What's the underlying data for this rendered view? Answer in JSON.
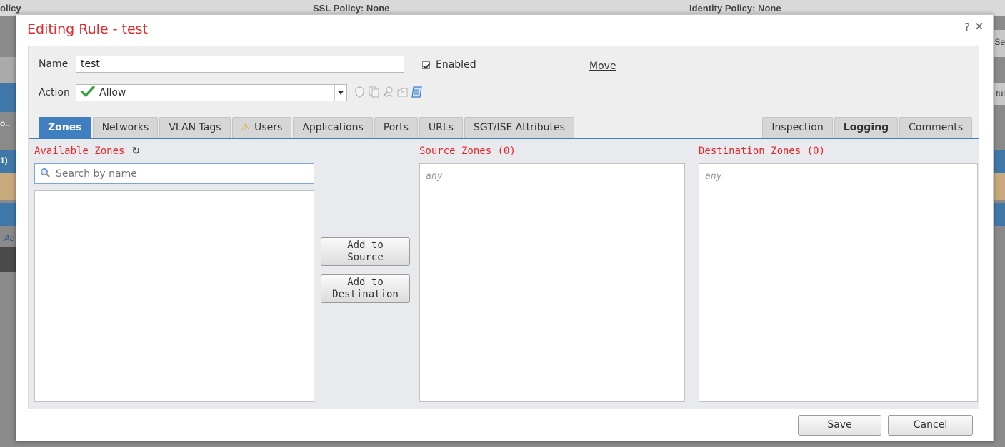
{
  "background": {
    "left_text": "olicy",
    "ssl_policy": "SSL Policy: None",
    "identity_policy": "Identity Policy: None",
    "right_text_1": "Se",
    "right_text_2": "tul",
    "left_text_2": "o..",
    "left_text_3": "1)",
    "left_text_4": "Ac"
  },
  "dialog": {
    "title": "Editing Rule - test",
    "help_label": "?",
    "close_label": "×"
  },
  "form": {
    "name_label": "Name",
    "name_value": "test",
    "enabled_label": "Enabled",
    "enabled_checked": true,
    "move_label": "Move",
    "action_label": "Action",
    "action_value": "Allow",
    "action_icons": [
      "shield-icon",
      "copy-icon",
      "user-search-icon",
      "folder-icon",
      "file-icon"
    ]
  },
  "tabs": {
    "left": [
      {
        "label": "Zones",
        "active": true
      },
      {
        "label": "Networks"
      },
      {
        "label": "VLAN Tags"
      },
      {
        "label": "Users",
        "warning": true
      },
      {
        "label": "Applications"
      },
      {
        "label": "Ports"
      },
      {
        "label": "URLs"
      },
      {
        "label": "SGT/ISE Attributes"
      }
    ],
    "right": [
      {
        "label": "Inspection"
      },
      {
        "label": "Logging",
        "bold": true
      },
      {
        "label": "Comments"
      }
    ]
  },
  "zones": {
    "available_heading": "Available Zones",
    "search_placeholder": "Search by name",
    "source_heading": "Source Zones (0)",
    "destination_heading": "Destination Zones (0)",
    "source_empty": "any",
    "destination_empty": "any",
    "add_to_source_line1": "Add to",
    "add_to_source_line2": "Source",
    "add_to_destination_line1": "Add to",
    "add_to_destination_line2": "Destination"
  },
  "footer": {
    "save_label": "Save",
    "cancel_label": "Cancel"
  },
  "colors": {
    "title_red": "#e8262b",
    "tab_active_blue": "#3f7fbf",
    "allow_green": "#3aa13a"
  }
}
